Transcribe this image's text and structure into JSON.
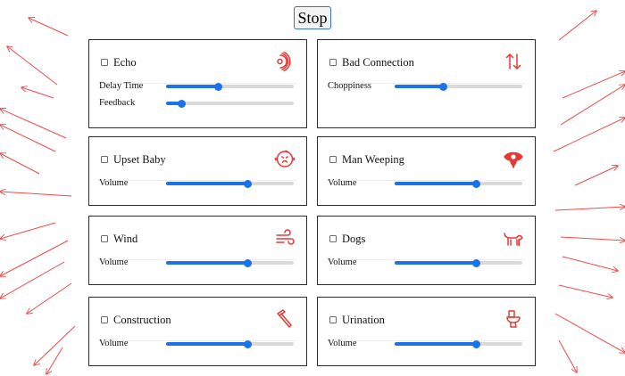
{
  "stop_label": "Stop",
  "colors": {
    "accent": "#1a73e8",
    "arrow": "#f04a4a",
    "icon": "#e53935"
  },
  "cards": [
    {
      "title": "Echo",
      "icon": "echo-waves-icon",
      "checked": false,
      "controls": [
        {
          "label": "Delay Time",
          "value": 0.41
        },
        {
          "label": "Feedback",
          "value": 0.12
        }
      ]
    },
    {
      "title": "Bad Connection",
      "icon": "up-down-arrows-icon",
      "checked": false,
      "controls": [
        {
          "label": "Choppiness",
          "value": 0.38
        }
      ]
    },
    {
      "title": "Upset Baby",
      "icon": "baby-face-icon",
      "checked": false,
      "controls": [
        {
          "label": "Volume",
          "value": 0.64
        }
      ]
    },
    {
      "title": "Man Weeping",
      "icon": "weeping-eye-icon",
      "checked": false,
      "controls": [
        {
          "label": "Volume",
          "value": 0.64
        }
      ]
    },
    {
      "title": "Wind",
      "icon": "wind-icon",
      "checked": false,
      "controls": [
        {
          "label": "Volume",
          "value": 0.64
        }
      ]
    },
    {
      "title": "Dogs",
      "icon": "dog-icon",
      "checked": false,
      "controls": [
        {
          "label": "Volume",
          "value": 0.64
        }
      ]
    },
    {
      "title": "Construction",
      "icon": "hammer-icon",
      "checked": false,
      "controls": [
        {
          "label": "Volume",
          "value": 0.64
        }
      ]
    },
    {
      "title": "Urination",
      "icon": "toilet-icon",
      "checked": false,
      "controls": [
        {
          "label": "Volume",
          "value": 0.64
        }
      ]
    }
  ]
}
